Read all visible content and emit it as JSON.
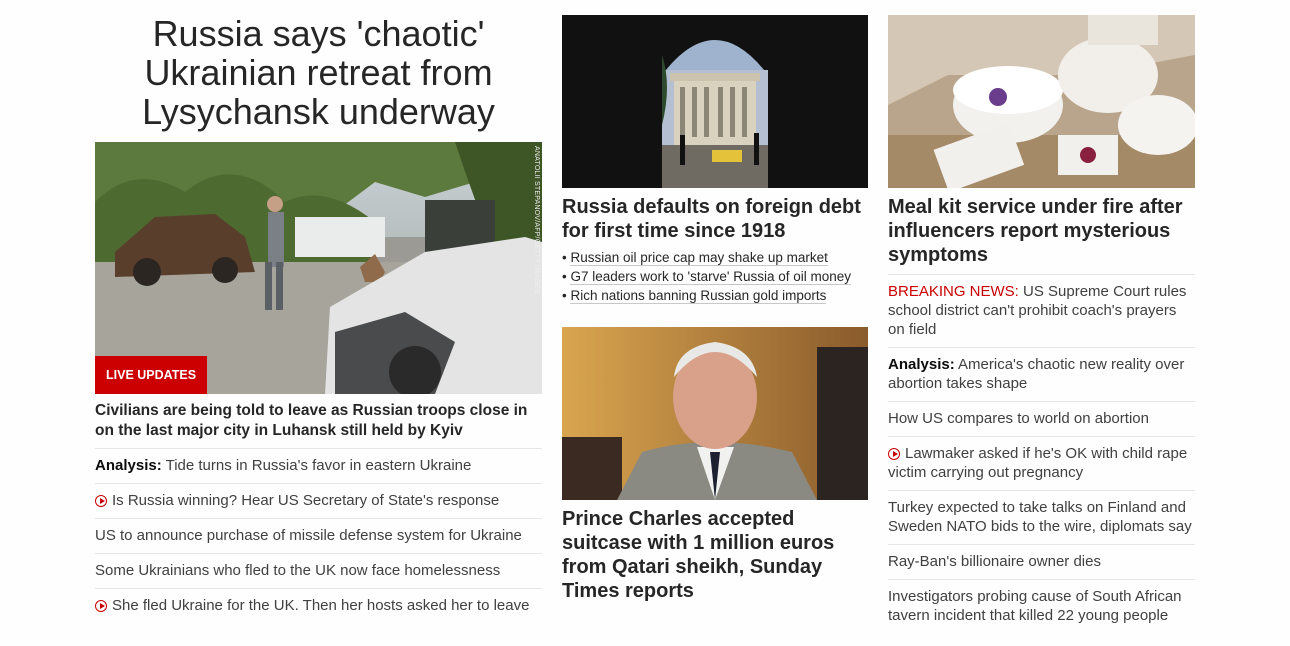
{
  "lead": {
    "headline": "Russia says 'chaotic' Ukrainian retreat from Lysychansk underway",
    "image_credit": "ANATOLII STEPANOV/AFP/GETTY IMAGES",
    "badge": "LIVE UPDATES",
    "story": "Civilians are being told to leave as Russian troops close in on the last major city in Luhansk still held by Kyiv",
    "items": [
      {
        "label": "Analysis:",
        "text": " Tide turns in Russia's favor in eastern Ukraine",
        "video": false
      },
      {
        "label": "",
        "text": "Is Russia winning? Hear US Secretary of State's response",
        "video": true
      },
      {
        "label": "",
        "text": "US to announce purchase of missile defense system for Ukraine",
        "video": false
      },
      {
        "label": "",
        "text": "Some Ukrainians who fled to the UK now face homelessness",
        "video": false
      },
      {
        "label": "",
        "text": "She fled Ukraine for the UK. Then her hosts asked her to leave",
        "video": true
      }
    ]
  },
  "middle": {
    "story1": {
      "title": "Russia defaults on foreign debt for first time since 1918",
      "bullets": [
        "Russian oil price cap may shake up market",
        "G7 leaders work to 'starve' Russia of oil money",
        "Rich nations banning Russian gold imports"
      ]
    },
    "story2": {
      "title": "Prince Charles accepted suitcase with 1 million euros from Qatari sheikh, Sunday Times reports"
    }
  },
  "right": {
    "story": "Meal kit service under fire after influencers report mysterious symptoms",
    "items": [
      {
        "breaking": "BREAKING NEWS:",
        "label": "",
        "text": " US Supreme Court rules school district can't prohibit coach's prayers on field",
        "video": false
      },
      {
        "breaking": "",
        "label": "Analysis:",
        "text": " America's chaotic new reality over abortion takes shape",
        "video": false
      },
      {
        "breaking": "",
        "label": "",
        "text": "How US compares to world on abortion",
        "video": false
      },
      {
        "breaking": "",
        "label": "",
        "text": "Lawmaker asked if he's OK with child rape victim carrying out pregnancy",
        "video": true
      },
      {
        "breaking": "",
        "label": "",
        "text": "Turkey expected to take talks on Finland and Sweden NATO bids to the wire, diplomats say",
        "video": false
      },
      {
        "breaking": "",
        "label": "",
        "text": "Ray-Ban's billionaire owner dies",
        "video": false
      },
      {
        "breaking": "",
        "label": "",
        "text": "Investigators probing cause of South African tavern incident that killed 22 young people",
        "video": false
      }
    ]
  },
  "colors": {
    "accent": "#cc0000",
    "text": "#0c0c0c",
    "divider": "#e6e6e6"
  },
  "icons": {
    "video": "play-circle-icon"
  }
}
